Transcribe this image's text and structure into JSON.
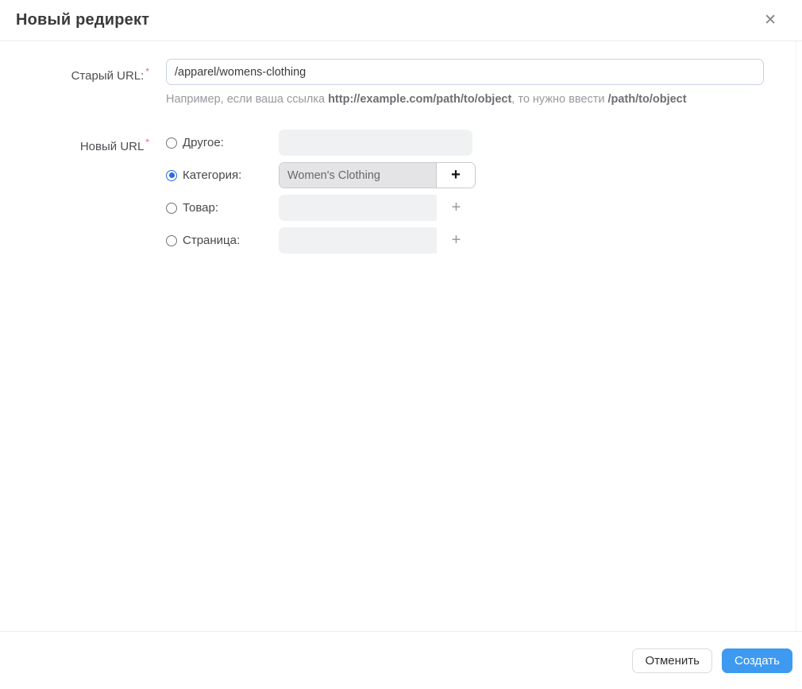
{
  "modal": {
    "title": "Новый редирект",
    "close_icon": "✕"
  },
  "form": {
    "old_url": {
      "label": "Старый URL:",
      "required_mark": "*",
      "value": "/apparel/womens-clothing",
      "help": {
        "part1": "Например, если ваша ссылка ",
        "bold1": "http://example.com/path/to/object",
        "part2": ", то нужно ввести ",
        "bold2": "/path/to/object"
      }
    },
    "new_url": {
      "label": "Новый URL",
      "required_mark": "*",
      "add_icon": "+",
      "options": [
        {
          "label": "Другое:",
          "selected": false,
          "value": "",
          "has_add_button": false
        },
        {
          "label": "Категория:",
          "selected": true,
          "value": "Women's Clothing",
          "has_add_button": true
        },
        {
          "label": "Товар:",
          "selected": false,
          "value": "",
          "has_add_button": true
        },
        {
          "label": "Страница:",
          "selected": false,
          "value": "",
          "has_add_button": true
        }
      ]
    }
  },
  "footer": {
    "cancel_label": "Отменить",
    "submit_label": "Создать"
  },
  "colors": {
    "primary": "#3d9af0",
    "required": "#f06478",
    "radio_selected": "#2b6be4"
  }
}
